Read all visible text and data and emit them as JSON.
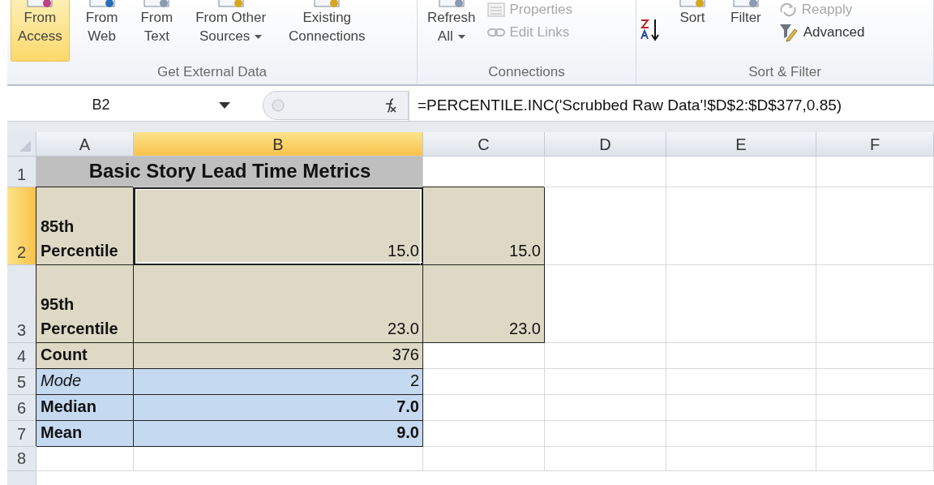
{
  "ribbon": {
    "groups": [
      {
        "label": "Get External Data",
        "buttons": [
          {
            "kind": "large",
            "lines": [
              "From",
              "Access"
            ],
            "hovered": true,
            "dropdown": false
          },
          {
            "kind": "large",
            "lines": [
              "From",
              "Web"
            ],
            "hovered": false,
            "dropdown": false
          },
          {
            "kind": "large",
            "lines": [
              "From",
              "Text"
            ],
            "hovered": false,
            "dropdown": false
          },
          {
            "kind": "large",
            "lines": [
              "From Other",
              "Sources"
            ],
            "hovered": false,
            "dropdown": true
          },
          {
            "kind": "large",
            "lines": [
              "Existing",
              "Connections"
            ],
            "hovered": false,
            "dropdown": false
          }
        ]
      },
      {
        "label": "Connections",
        "buttons": [
          {
            "kind": "large",
            "lines": [
              "Refresh",
              "All"
            ],
            "hovered": false,
            "dropdown": true
          },
          {
            "kind": "stack",
            "items": [
              {
                "label": "Properties",
                "disabled": true
              },
              {
                "label": "Edit Links",
                "disabled": true
              }
            ]
          }
        ]
      },
      {
        "label": "Sort & Filter",
        "buttons": [
          {
            "kind": "sorticon"
          },
          {
            "kind": "large",
            "lines": [
              "Sort"
            ],
            "hovered": false,
            "dropdown": false
          },
          {
            "kind": "large",
            "lines": [
              "Filter"
            ],
            "hovered": false,
            "dropdown": false
          },
          {
            "kind": "stack",
            "items": [
              {
                "label": "Reapply",
                "disabled": true
              },
              {
                "label": "Advanced",
                "disabled": false
              }
            ]
          }
        ]
      }
    ]
  },
  "formula_bar": {
    "name_box": "B2",
    "formula": "=PERCENTILE.INC('Scrubbed Raw Data'!$D$2:$D$377,0.85)"
  },
  "sheet": {
    "columns": [
      {
        "label": "A",
        "selected": false
      },
      {
        "label": "B",
        "selected": true
      },
      {
        "label": "C",
        "selected": false
      },
      {
        "label": "D",
        "selected": false
      },
      {
        "label": "E",
        "selected": false
      },
      {
        "label": "F",
        "selected": false
      }
    ],
    "rows": [
      {
        "header": "1",
        "selected": false,
        "cells": [
          {
            "kind": "title",
            "text": "Basic Story Lead Time Metrics",
            "color": "#bfbfbf",
            "merged": true,
            "selected": false
          }
        ]
      },
      {
        "header": "2",
        "selected": true,
        "cells": [
          {
            "kind": "label",
            "text": "85th Percentile",
            "color": "#ddd9c4",
            "merged": false,
            "selected": false
          },
          {
            "kind": "value",
            "text": "15.0",
            "color": "#ddd9c4",
            "merged": false,
            "selected": true
          },
          {
            "kind": "value",
            "text": "15.0",
            "color": "#ddd9c4",
            "merged": false,
            "selected": false
          }
        ]
      },
      {
        "header": "3",
        "selected": false,
        "cells": [
          {
            "kind": "label",
            "text": "95th Percentile",
            "color": "#ddd9c4",
            "merged": false,
            "selected": false
          },
          {
            "kind": "value",
            "text": "23.0",
            "color": "#ddd9c4",
            "merged": false,
            "selected": false
          },
          {
            "kind": "value",
            "text": "23.0",
            "color": "#ddd9c4",
            "merged": false,
            "selected": false
          }
        ]
      },
      {
        "header": "4",
        "selected": false,
        "cells": [
          {
            "kind": "label",
            "text": "Count",
            "color": "#ddd9c4",
            "merged": false,
            "selected": false
          },
          {
            "kind": "value",
            "text": "376",
            "color": "#ddd9c4",
            "merged": false,
            "selected": false
          }
        ]
      },
      {
        "header": "5",
        "selected": false,
        "cells": [
          {
            "kind": "italic-label",
            "text": "Mode",
            "color": "#c5d9f1",
            "merged": false,
            "selected": false
          },
          {
            "kind": "value",
            "text": "2",
            "color": "#c5d9f1",
            "merged": false,
            "selected": false
          }
        ]
      },
      {
        "header": "6",
        "selected": false,
        "cells": [
          {
            "kind": "label",
            "text": "Median",
            "color": "#c5d9f1",
            "merged": false,
            "selected": false
          },
          {
            "kind": "bold-value",
            "text": "7.0",
            "color": "#c5d9f1",
            "merged": false,
            "selected": false
          }
        ]
      },
      {
        "header": "7",
        "selected": false,
        "cells": [
          {
            "kind": "label",
            "text": "Mean",
            "color": "#c5d9f1",
            "merged": false,
            "selected": false
          },
          {
            "kind": "bold-value",
            "text": "9.0",
            "color": "#c5d9f1",
            "merged": false,
            "selected": false
          }
        ]
      },
      {
        "header": "8",
        "selected": false,
        "cells": []
      }
    ]
  }
}
